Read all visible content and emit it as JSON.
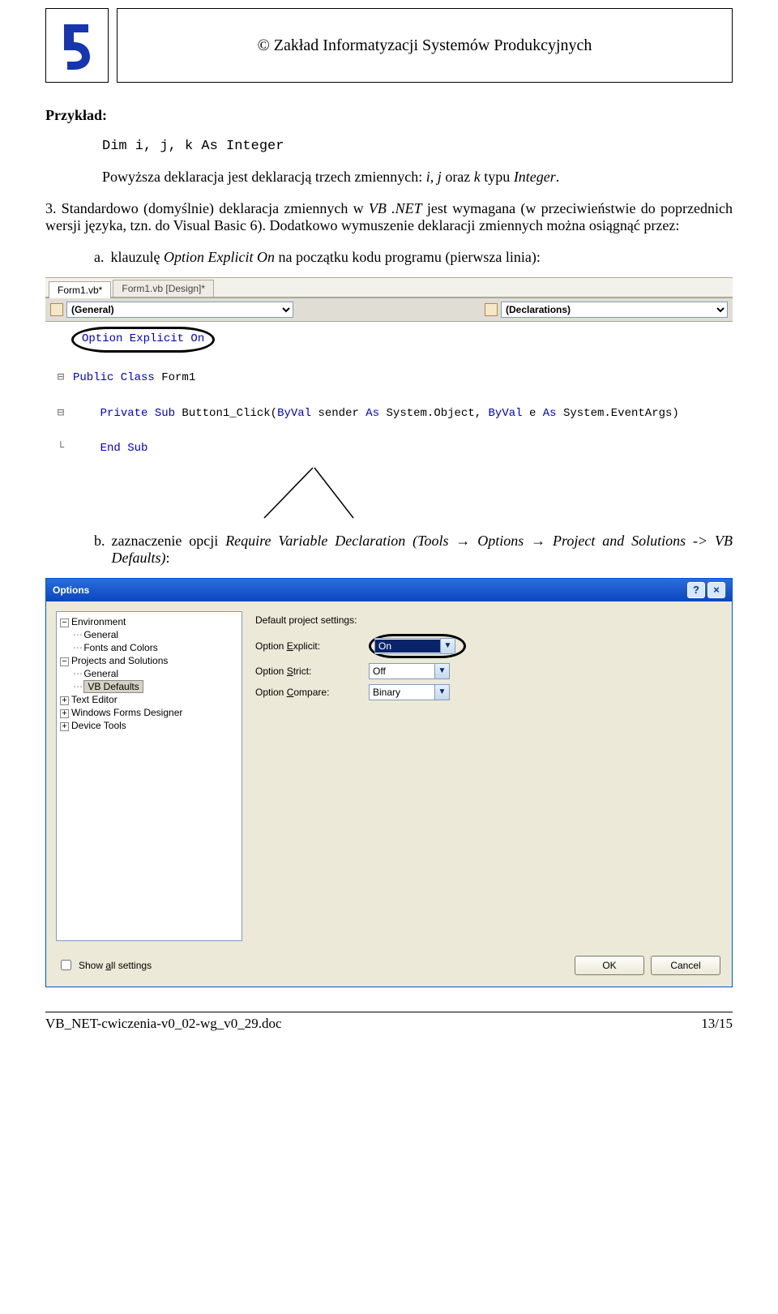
{
  "header": {
    "org": "© Zakład Informatyzacji Systemów Produkcyjnych"
  },
  "doc": {
    "przyklad_heading": "Przykład:",
    "code_line": "Dim i, j, k As Integer",
    "para1_prefix": "Powyższa deklaracja jest deklaracją trzech zmiennych: ",
    "para1_vars": "i, j",
    "para1_mid": " oraz ",
    "para1_k": "k",
    "para1_suffix": " typu ",
    "para1_type": "Integer",
    "para1_end": ".",
    "para2_prefix": "3. Standardowo (domyślnie) deklaracja zmiennych w ",
    "para2_vb": "VB .NET",
    "para2_rest": " jest wymagana (w przeciwieństwie do poprzednich wersji języka, tzn. do Visual Basic 6). Dodatkowo wymuszenie deklaracji zmiennych można osiągnąć przez:",
    "li_a_marker": "a.",
    "li_a_prefix": "klauzulę ",
    "li_a_opt": "Option Explicit On",
    "li_a_suffix": " na początku kodu programu (pierwsza linia):",
    "li_b_marker": "b.",
    "li_b_prefix": "zaznaczenie opcji ",
    "li_b_opt": "Require Variable Declaration (Tools → Options → Project and Solutions -> VB Defaults)",
    "li_b_suffix": ":"
  },
  "vs": {
    "tab_active": "Form1.vb*",
    "tab_inactive": "Form1.vb [Design]*",
    "dd_left": "(General)",
    "dd_right": "(Declarations)",
    "code_opt": "Option Explicit On",
    "code_class_kw": "Public Class",
    "code_class_name": " Form1",
    "code_sub_kw": "Private Sub",
    "code_sub_name": " Button1_Click(",
    "code_byval1": "ByVal",
    "code_arg1": " sender ",
    "code_as1": "As",
    "code_type1": " System.Object, ",
    "code_byval2": "ByVal",
    "code_arg2": " e ",
    "code_as2": "As",
    "code_type2": " System.EventArgs)",
    "code_end": "End Sub"
  },
  "dlg": {
    "title": "Options",
    "help_q": "?",
    "close_x": "×",
    "tree": {
      "env": "Environment",
      "general": "General",
      "fonts": "Fonts and Colors",
      "proj": "Projects and Solutions",
      "general2": "General",
      "vbdef": "VB Defaults",
      "txt": "Text Editor",
      "wfd": "Windows Forms Designer",
      "dev": "Device Tools"
    },
    "main_heading": "Default project settings:",
    "opt_explicit": "Option Explicit:",
    "opt_explicit_u": "E",
    "opt_strict": "Option Strict:",
    "opt_strict_u": "S",
    "opt_compare": "Option Compare:",
    "opt_compare_u": "C",
    "val_on": "On",
    "val_off": "Off",
    "val_binary": "Binary",
    "show_all": "Show all settings",
    "show_all_u": "a",
    "ok": "OK",
    "cancel": "Cancel"
  },
  "footer": {
    "file": "VB_NET-cwiczenia-v0_02-wg_v0_29.doc",
    "page": "13/15"
  }
}
